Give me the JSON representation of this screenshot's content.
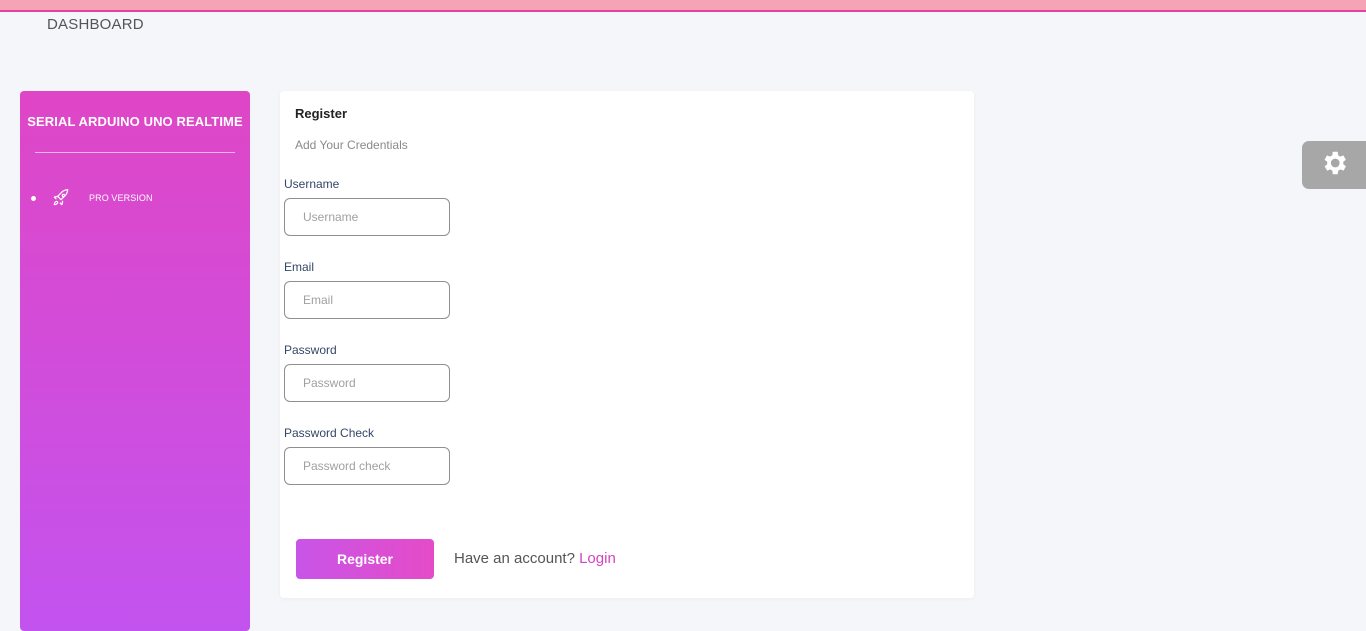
{
  "header": {
    "title": "DASHBOARD"
  },
  "sidebar": {
    "title": "SERIAL ARDUINO UNO REALTIME",
    "items": [
      {
        "label": "PRO VERSION",
        "icon": "rocket-icon"
      }
    ],
    "gradient_top": "#df46c6",
    "gradient_bottom": "#c353ef"
  },
  "form": {
    "title": "Register",
    "subtitle": "Add Your Credentials",
    "fields": [
      {
        "label": "Username",
        "placeholder": "Username",
        "value": ""
      },
      {
        "label": "Email",
        "placeholder": "Email",
        "value": ""
      },
      {
        "label": "Password",
        "placeholder": "Password",
        "value": ""
      },
      {
        "label": "Password Check",
        "placeholder": "Password check",
        "value": ""
      }
    ],
    "submit_label": "Register",
    "account_prompt": "Have an account?",
    "login_label": "Login"
  },
  "settings": {
    "icon": "gear-icon"
  },
  "colors": {
    "accent": "#d543c3",
    "topbar": "#f7a3b6",
    "settings_tab": "#a7a7a7"
  }
}
